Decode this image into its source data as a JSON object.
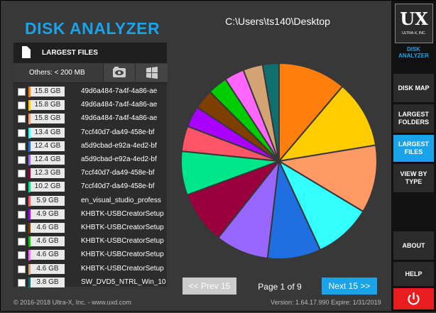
{
  "app": {
    "title": "DISK ANALYZER",
    "path": "C:\\Users\\ts140\\Desktop"
  },
  "panel": {
    "title": "LARGEST FILES",
    "others": "Others:  < 200 MB",
    "icons": [
      "document-icon",
      "eye-icon",
      "windows-icon"
    ]
  },
  "files": [
    {
      "size": "15.8 GB",
      "name": "49d6a484-7a4f-4a86-ae",
      "color": "#ff7f0e"
    },
    {
      "size": "15.8 GB",
      "name": "49d6a484-7a4f-4a86-ae",
      "color": "#ffcc00"
    },
    {
      "size": "15.8 GB",
      "name": "49d6a484-7a4f-4a86-ae",
      "color": "#ff9966"
    },
    {
      "size": "13.4 GB",
      "name": "7ccf40d7-da49-458e-bf",
      "color": "#33ffff"
    },
    {
      "size": "12.4 GB",
      "name": "a5d9cbad-e92a-4ed2-bf",
      "color": "#1f6fe0"
    },
    {
      "size": "12.4 GB",
      "name": "a5d9cbad-e92a-4ed2-bf",
      "color": "#9966ff"
    },
    {
      "size": "12.3 GB",
      "name": "7ccf40d7-da49-458e-bf",
      "color": "#99003d"
    },
    {
      "size": "10.2 GB",
      "name": "7ccf40d7-da49-458e-bf",
      "color": "#00e68a"
    },
    {
      "size": "5.9 GB",
      "name": "en_visual_studio_profess",
      "color": "#ff5566"
    },
    {
      "size": "4.9 GB",
      "name": "KHBTK-USBCreatorSetup",
      "color": "#aa00ff"
    },
    {
      "size": "4.6 GB",
      "name": "KHBTK-USBCreatorSetup",
      "color": "#7f3f00"
    },
    {
      "size": "4.6 GB",
      "name": "KHBTK-USBCreatorSetup",
      "color": "#00cc00"
    },
    {
      "size": "4.6 GB",
      "name": "KHBTK-USBCreatorSetup",
      "color": "#ff66ff"
    },
    {
      "size": "4.6 GB",
      "name": "KHBTK-USBCreatorSetup",
      "color": "#d4a373"
    },
    {
      "size": "3.8 GB",
      "name": "SW_DVD5_NTRL_Win_10",
      "color": "#0f6f6f"
    }
  ],
  "pagination": {
    "prev": "<< Prev 15",
    "page": "Page 1 of 9",
    "next": "Next 15 >>"
  },
  "footer": {
    "copyright": "© 2016-2018 Ultra-X, Inc. - www.uxd.com",
    "version": "Version: 1.64.17.990   Expire: 1/31/2019"
  },
  "sidebar": {
    "logo": "UX",
    "logo_sub": "ULTRA-X, INC.",
    "subtitle": "DISK ANALYZER",
    "buttons": [
      {
        "label": "DISK MAP",
        "active": false
      },
      {
        "label": "LARGEST FOLDERS",
        "active": false
      },
      {
        "label": "LARGEST FILES",
        "active": true
      },
      {
        "label": "VIEW BY TYPE",
        "active": false
      },
      {
        "label": "ABOUT",
        "active": false
      },
      {
        "label": "HELP",
        "active": false
      }
    ]
  },
  "colors": {
    "accent": "#1aa3e8",
    "power": "#e81d1d"
  }
}
